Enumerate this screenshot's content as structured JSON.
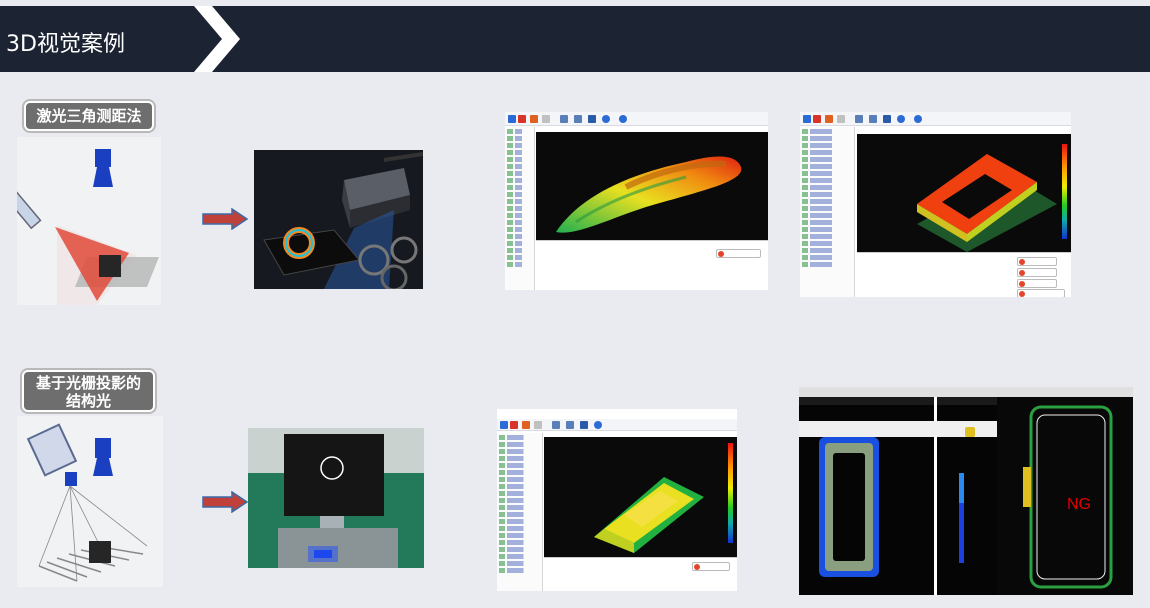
{
  "header": {
    "title": "3D视觉案例"
  },
  "section1": {
    "label": "激光三角测距法"
  },
  "section2": {
    "label_line1": "基于光栅投影的",
    "label_line2": "结构光"
  },
  "result": {
    "ng_text": "NG"
  },
  "colors": {
    "header_bg": "#1c2333",
    "arrow_fill": "#c0403a",
    "arrow_outline": "#3a6aa8",
    "badge_bg": "#6e6e6e",
    "ng_red": "#e10000"
  }
}
